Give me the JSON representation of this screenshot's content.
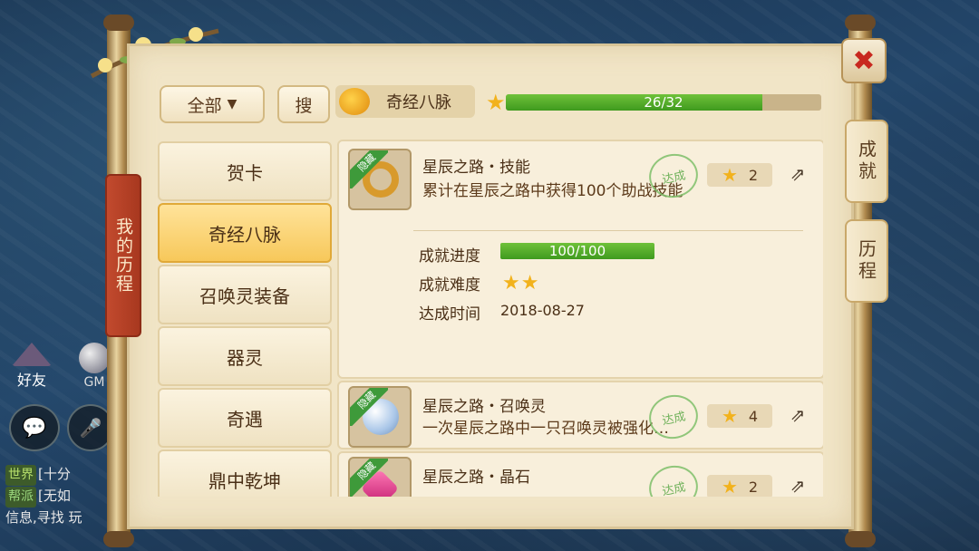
{
  "background_hud": {
    "friend_label": "好友",
    "gm_label": "GM",
    "chat_lines": [
      {
        "tag": "世界",
        "text": "[十分"
      },
      {
        "tag": "帮派",
        "text": "[无如"
      },
      {
        "tag": "",
        "text": "信息,寻找 玩"
      }
    ]
  },
  "scroll": {
    "left_tab_label": "我的历程",
    "right_tabs": [
      {
        "label": "成就",
        "active": true
      },
      {
        "label": "历程",
        "active": false
      }
    ],
    "close_icon": "close-x"
  },
  "toolbar": {
    "filter_label": "全部",
    "search_label": "搜",
    "current_category": "奇经八脉",
    "progress_text": "26/32",
    "progress_fraction": 0.8125
  },
  "categories": [
    {
      "label": "贺卡",
      "active": false
    },
    {
      "label": "奇经八脉",
      "active": true
    },
    {
      "label": "召唤灵装备",
      "active": false
    },
    {
      "label": "器灵",
      "active": false
    },
    {
      "label": "奇遇",
      "active": false
    },
    {
      "label": "鼎中乾坤",
      "active": false
    }
  ],
  "achievements": [
    {
      "ribbon": "隐藏",
      "title": "星辰之路・技能",
      "desc": "累计在星辰之路中获得100个助战技能",
      "stamp": "达成",
      "points": "2",
      "expanded": true,
      "progress_label": "成就进度",
      "progress_text": "100/100",
      "progress_fraction": 1.0,
      "difficulty_label": "成就难度",
      "difficulty_stars": 2,
      "time_label": "达成时间",
      "time_value": "2018-08-27",
      "icon": "golden-ring-icon"
    },
    {
      "ribbon": "隐藏",
      "title": "星辰之路・召唤灵",
      "desc": "一次星辰之路中一只召唤灵被强化…",
      "stamp": "达成",
      "points": "4",
      "expanded": false,
      "icon": "crystal-orb-icon"
    },
    {
      "ribbon": "隐藏",
      "title": "星辰之路・晶石",
      "desc": "",
      "stamp": "达成",
      "points": "2",
      "expanded": false,
      "icon": "pink-gem-icon"
    }
  ],
  "colors": {
    "progress_green": "#4fae28",
    "star_gold": "#f2b21c",
    "active_category": "#f7c85a",
    "close_red": "#c8281f"
  }
}
